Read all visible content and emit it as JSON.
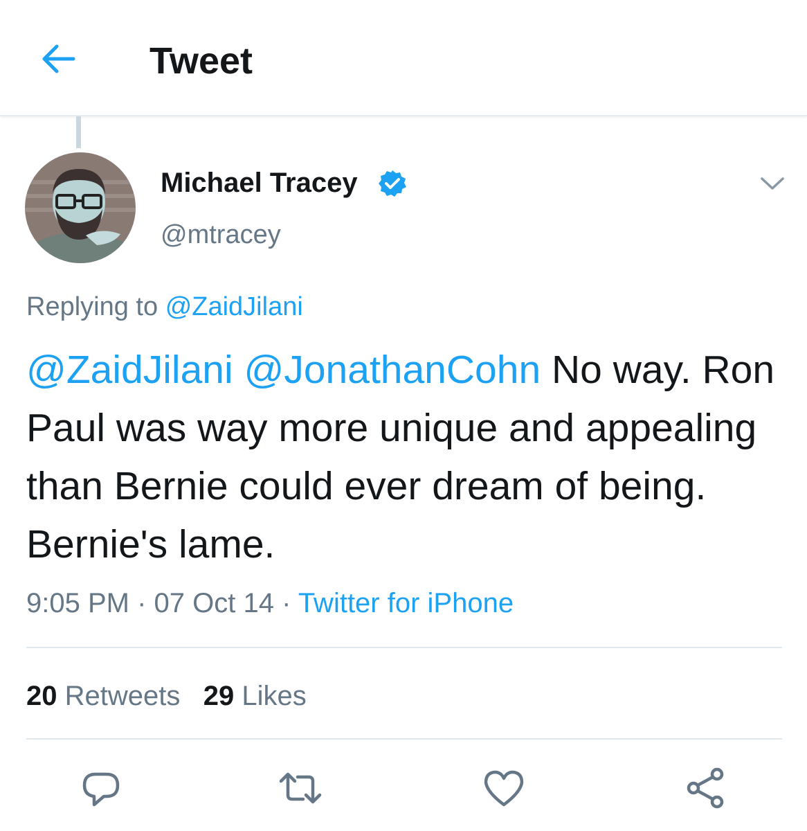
{
  "header": {
    "title": "Tweet",
    "back_icon": "arrow-left-icon"
  },
  "author": {
    "name": "Michael Tracey",
    "handle": "@mtracey",
    "verified": true,
    "verified_icon": "verified-badge-icon"
  },
  "reply": {
    "prefix": "Replying to",
    "to": "@ZaidJilani"
  },
  "tweet": {
    "mention_1": "@ZaidJilani",
    "mention_2": "@JonathanCohn",
    "text": "No way. Ron Paul was way more unique and appealing than Bernie could ever dream of being. Bernie's lame."
  },
  "meta": {
    "time": "9:05 PM",
    "sep1": "·",
    "date": "07 Oct 14",
    "sep2": "·",
    "source": "Twitter for iPhone"
  },
  "stats": {
    "retweets_count": "20",
    "retweets_label": "Retweets",
    "likes_count": "29",
    "likes_label": "Likes"
  },
  "actions": [
    "reply-icon",
    "retweet-icon",
    "like-icon",
    "share-icon"
  ],
  "colors": {
    "accent": "#1da1f2",
    "muted": "#657786",
    "text": "#14171a",
    "divider": "#e1e8ed"
  }
}
